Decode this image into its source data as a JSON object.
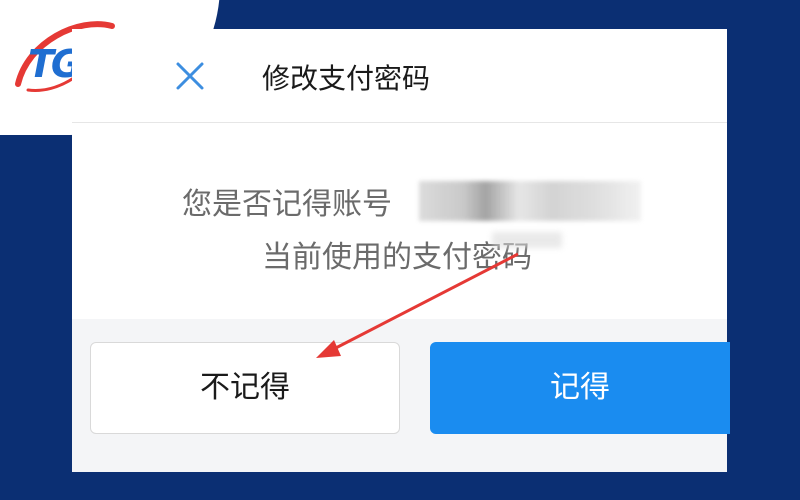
{
  "logo": {
    "text": "TG"
  },
  "dialog": {
    "title": "修改支付密码",
    "message_line1": "您是否记得账号",
    "message_line2": "当前使用的支付密码",
    "btn_not_remember": "不记得",
    "btn_remember": "记得"
  },
  "colors": {
    "background": "#0b2f73",
    "primary_button": "#1a8cf0",
    "arrow": "#e53935"
  },
  "icons": [
    "close-icon",
    "arrow-annotation"
  ]
}
